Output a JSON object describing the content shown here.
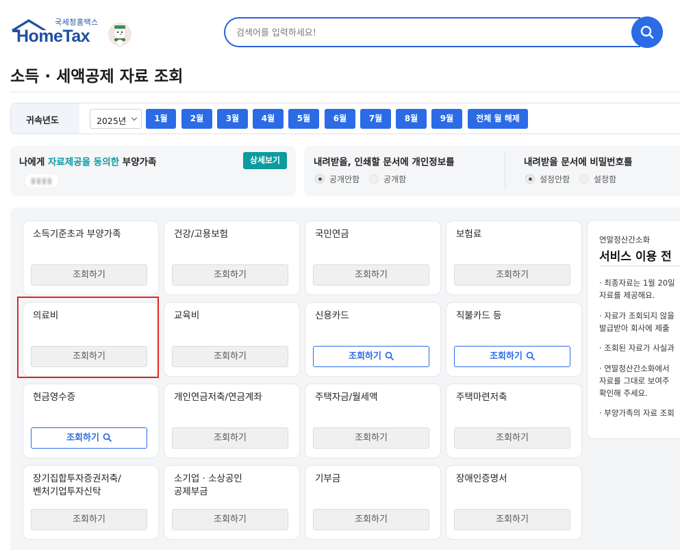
{
  "header": {
    "logo_small": "국세청홈택스",
    "logo_main": "HomeTax",
    "search_placeholder": "검색어를 입력하세요!"
  },
  "page_title": "소득 · 세액공제 자료 조회",
  "filter": {
    "label": "귀속년도",
    "year": "2025년",
    "months": [
      "1월",
      "2월",
      "3월",
      "4월",
      "5월",
      "6월",
      "7월",
      "8월",
      "9월"
    ],
    "clear_all": "전체 월 해제"
  },
  "dependents": {
    "text_before": "나에게 ",
    "text_highlight": "자료제공을 동의한",
    "text_after": " 부양가족",
    "detail_button": "상세보기"
  },
  "privacy_option": {
    "heading": "내려받을, 인쇄할 문서에 개인정보를",
    "options": [
      "공개안함",
      "공개함"
    ],
    "selected": "공개안함"
  },
  "password_option": {
    "heading": "내려받을 문서에 비밀번호를",
    "options": [
      "설정안함",
      "설정함"
    ],
    "selected": "설정안함"
  },
  "cards": [
    {
      "title": "소득기준초과 부양가족",
      "button": "조회하기",
      "active": false
    },
    {
      "title": "건강/고용보험",
      "button": "조회하기",
      "active": false
    },
    {
      "title": "국민연금",
      "button": "조회하기",
      "active": false
    },
    {
      "title": "보험료",
      "button": "조회하기",
      "active": false
    },
    {
      "title": "의료비",
      "button": "조회하기",
      "active": false
    },
    {
      "title": "교육비",
      "button": "조회하기",
      "active": false
    },
    {
      "title": "신용카드",
      "button": "조회하기",
      "active": true
    },
    {
      "title": "직불카드 등",
      "button": "조회하기",
      "active": true
    },
    {
      "title": "현금영수증",
      "button": "조회하기",
      "active": true
    },
    {
      "title": "개인연금저축/연금계좌",
      "button": "조회하기",
      "active": false
    },
    {
      "title": "주택자금/월세액",
      "button": "조회하기",
      "active": false
    },
    {
      "title": "주택마련저축",
      "button": "조회하기",
      "active": false
    },
    {
      "title_lines": [
        "장기집합투자증권저축/",
        "벤처기업투자신탁"
      ],
      "button": "조회하기",
      "active": false
    },
    {
      "title_lines": [
        "소기업 · 소상공인",
        "공제부금"
      ],
      "button": "조회하기",
      "active": false
    },
    {
      "title": "기부금",
      "button": "조회하기",
      "active": false
    },
    {
      "title": "장애인증명서",
      "button": "조회하기",
      "active": false
    }
  ],
  "side_panel": {
    "subtitle": "연말정산간소화",
    "heading": "서비스 이용 전",
    "notes": [
      "· 최종자료는 1월 20일",
      "  자료를 제공해요.",
      "· 자료가 조회되지 않을",
      "  발급받아 회사에 제출",
      "· 조회된 자료가 사실과",
      "· 연말정산간소화에서",
      "  자료를 그대로 보여주",
      "  확인해 주세요.",
      "· 부양가족의 자료 조회"
    ]
  },
  "colors": {
    "primary": "#2b6be6",
    "teal": "#0d9b9e",
    "highlight_border": "#e02424"
  }
}
